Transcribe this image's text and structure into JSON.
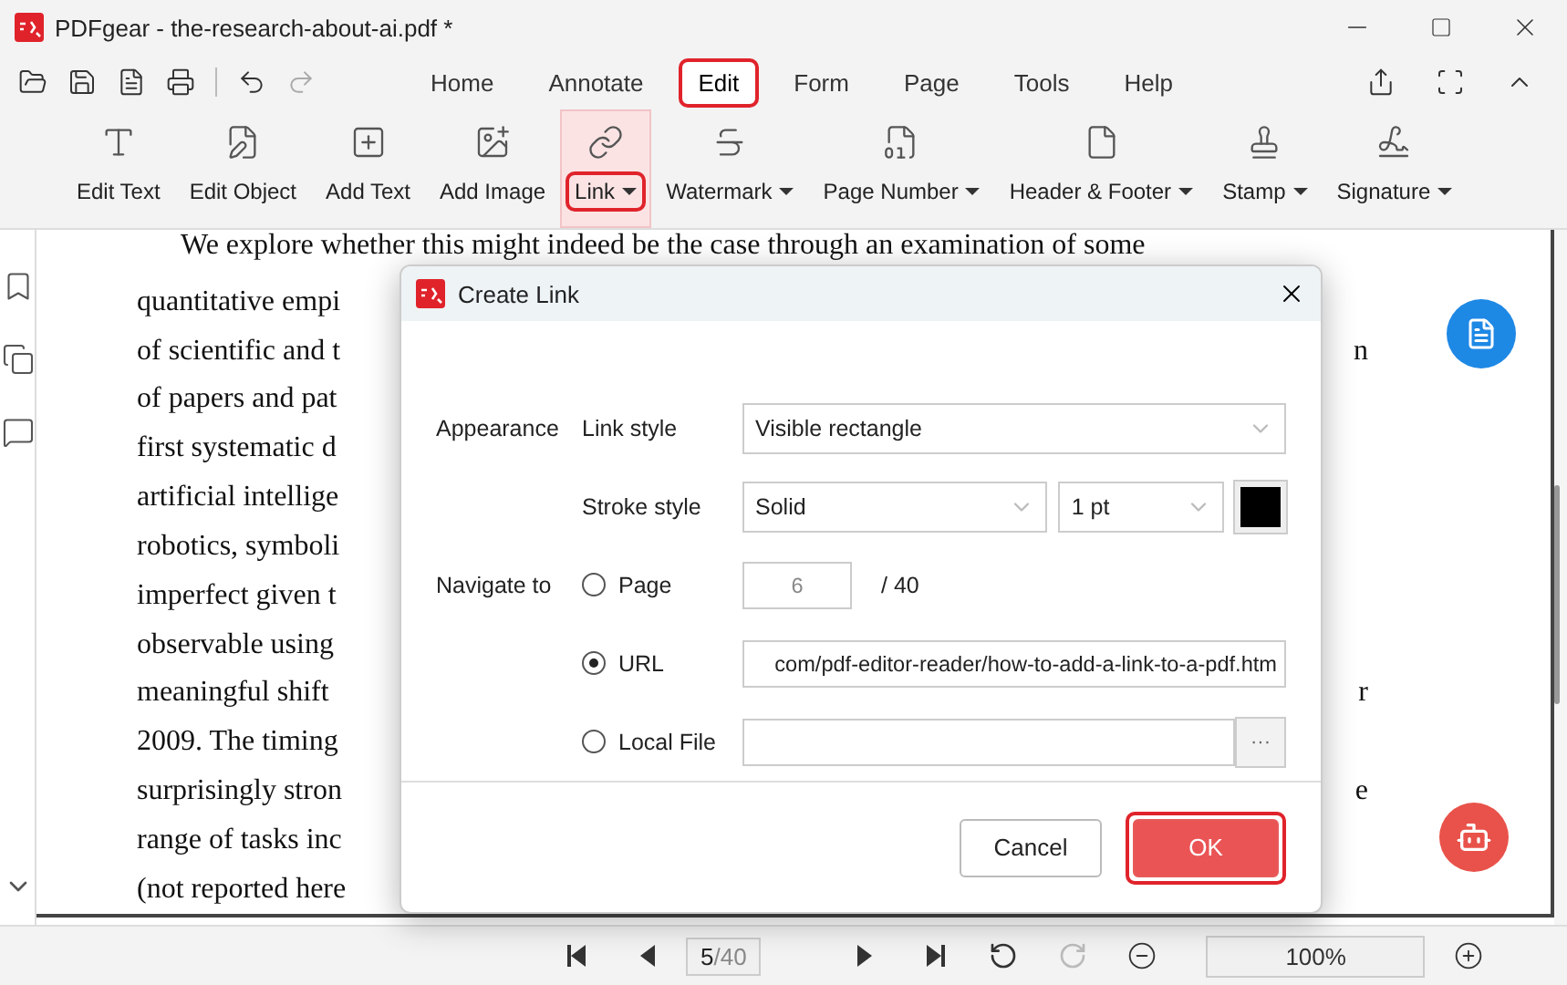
{
  "window": {
    "title": "PDFgear - the-research-about-ai.pdf *"
  },
  "menu_tabs": [
    {
      "label": "Home",
      "selected": false,
      "highlighted": false
    },
    {
      "label": "Annotate",
      "selected": false,
      "highlighted": false
    },
    {
      "label": "Edit",
      "selected": true,
      "highlighted": true
    },
    {
      "label": "Form",
      "selected": false,
      "highlighted": false
    },
    {
      "label": "Page",
      "selected": false,
      "highlighted": false
    },
    {
      "label": "Tools",
      "selected": false,
      "highlighted": false
    },
    {
      "label": "Help",
      "selected": false,
      "highlighted": false
    }
  ],
  "ribbon": [
    {
      "label": "Edit Text",
      "dropdown": false,
      "selected": false,
      "highlighted": false
    },
    {
      "label": "Edit Object",
      "dropdown": false,
      "selected": false,
      "highlighted": false
    },
    {
      "label": "Add Text",
      "dropdown": false,
      "selected": false,
      "highlighted": false
    },
    {
      "label": "Add Image",
      "dropdown": false,
      "selected": false,
      "highlighted": false
    },
    {
      "label": "Link",
      "dropdown": true,
      "selected": true,
      "highlighted": true
    },
    {
      "label": "Watermark",
      "dropdown": true,
      "selected": false,
      "highlighted": false
    },
    {
      "label": "Page Number",
      "dropdown": true,
      "selected": false,
      "highlighted": false
    },
    {
      "label": "Header & Footer",
      "dropdown": true,
      "selected": false,
      "highlighted": false
    },
    {
      "label": "Stamp",
      "dropdown": true,
      "selected": false,
      "highlighted": false
    },
    {
      "label": "Signature",
      "dropdown": true,
      "selected": false,
      "highlighted": false
    }
  ],
  "document": {
    "lines": [
      {
        "left": "We explore whether this might indeed be the case through an examination of some",
        "indent": true
      },
      {
        "left": "quantitative empi"
      },
      {
        "left": "of scientific and t",
        "right": "n"
      },
      {
        "left": "of papers and pat"
      },
      {
        "left": "first systematic d"
      },
      {
        "left": "artificial intellige"
      },
      {
        "left": "robotics, symboli"
      },
      {
        "left": "imperfect given t"
      },
      {
        "left": "observable using"
      },
      {
        "left": "meaningful shift",
        "right": "r"
      },
      {
        "left": "2009.  The timing"
      },
      {
        "left": "surprisingly stron",
        "right": "e"
      },
      {
        "left": "range of tasks inc"
      },
      {
        "left": "(not reported here"
      }
    ]
  },
  "dialog": {
    "title": "Create Link",
    "appearance_label": "Appearance",
    "navigate_label": "Navigate to",
    "link_style": {
      "label": "Link style",
      "value": "Visible rectangle"
    },
    "stroke_style": {
      "label": "Stroke style",
      "value": "Solid"
    },
    "stroke_width": {
      "value": "1 pt"
    },
    "stroke_color": {
      "color": "#000000"
    },
    "targets": [
      {
        "kind": "page",
        "label": "Page",
        "selected": false,
        "value": "6",
        "disabled": true,
        "suffix": "/ 40"
      },
      {
        "kind": "url",
        "label": "URL",
        "selected": true,
        "value": "com/pdf-editor-reader/how-to-add-a-link-to-a-pdf.htm"
      },
      {
        "kind": "file",
        "label": "Local File",
        "selected": false,
        "browse": "···"
      }
    ],
    "buttons": [
      {
        "label": "Cancel",
        "primary": false,
        "highlighted": false
      },
      {
        "label": "OK",
        "primary": true,
        "highlighted": true
      }
    ]
  },
  "page_nav": {
    "current": "5",
    "total": "/40",
    "zoom": "100%"
  }
}
